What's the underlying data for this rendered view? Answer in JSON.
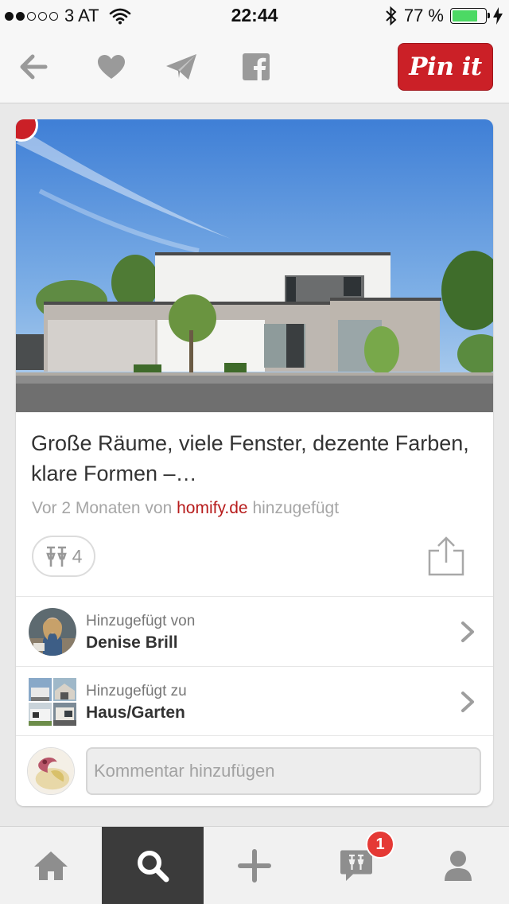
{
  "status_bar": {
    "carrier": "3 AT",
    "signal_bars_filled": 2,
    "signal_bars_total": 5,
    "time": "22:44",
    "battery_percent_label": "77 %",
    "battery_level": 0.77,
    "icons": [
      "wifi-icon",
      "bluetooth-icon",
      "battery-icon",
      "charging-bolt-icon"
    ]
  },
  "top_nav": {
    "icons": [
      "back-arrow-icon",
      "heart-icon",
      "send-icon",
      "facebook-icon"
    ],
    "pin_it_label": "Pin it"
  },
  "pin": {
    "title": "Große Räume, viele Fenster, dezente Farben, klare Formen –…",
    "meta_prefix": "Vor 2 Monaten von ",
    "meta_source": "homify.de",
    "meta_suffix": " hinzugefügt",
    "repin_count": "4",
    "image_description_icon": "house-photo",
    "added_by": {
      "label": "Hinzugefügt von",
      "name": "Denise Brill"
    },
    "added_to": {
      "label": "Hinzugefügt zu",
      "board": "Haus/Garten"
    },
    "comment_placeholder": "Kommentar hinzufügen"
  },
  "tab_bar": {
    "tabs": [
      "home-icon",
      "search-icon",
      "plus-icon",
      "news-icon",
      "profile-icon"
    ],
    "active_tab": "search-icon",
    "notification_count": "1"
  },
  "colors": {
    "brand_red": "#cb2027",
    "source_link": "#b71c1c",
    "active_tab_bg": "#3b3b3b",
    "badge_red": "#e53935",
    "battery_green": "#4cd964"
  }
}
